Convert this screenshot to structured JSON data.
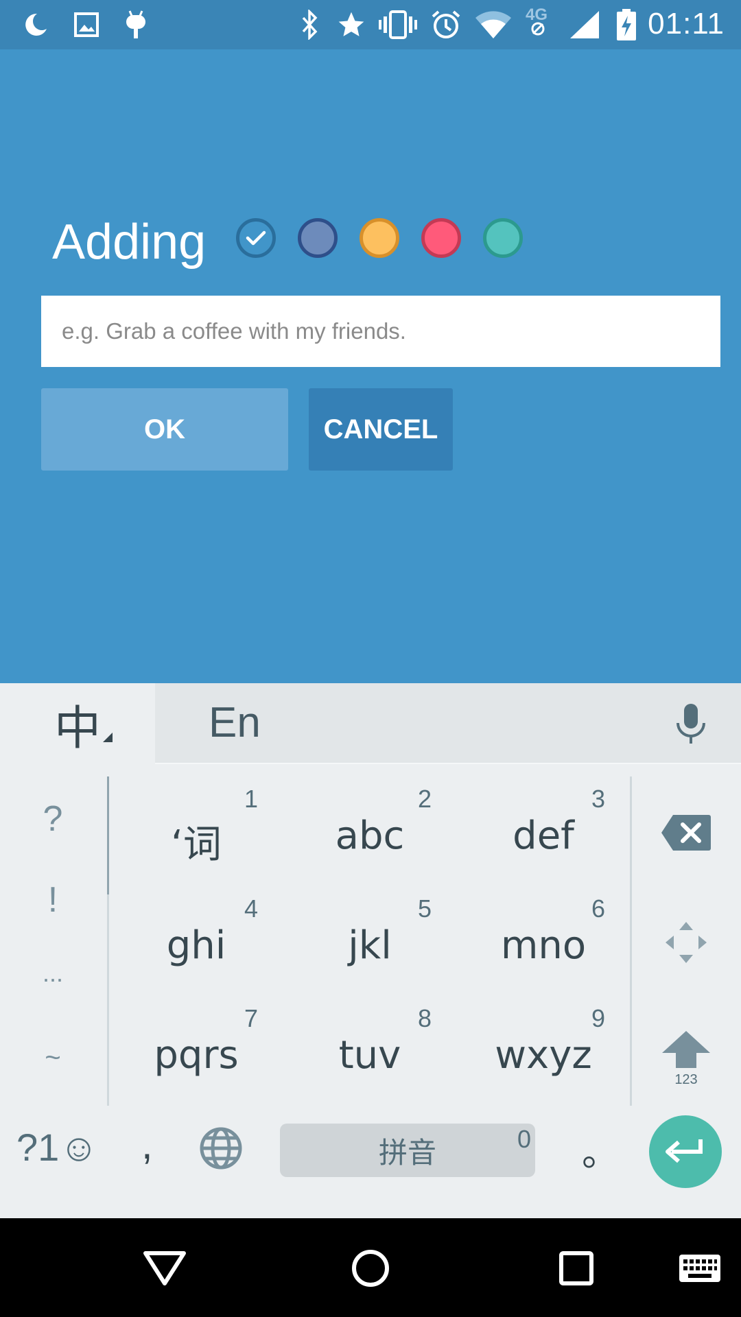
{
  "status_bar": {
    "time": "01:11",
    "network_label": "4G",
    "icons": [
      "moon-icon",
      "image-icon",
      "android-icon",
      "bluetooth-icon",
      "star-icon",
      "vibrate-icon",
      "alarm-icon",
      "wifi-icon",
      "data-off-icon",
      "signal-icon",
      "battery-charging-icon"
    ]
  },
  "main": {
    "title": "Adding",
    "colors": [
      {
        "name": "blue",
        "fill": "#4195c9",
        "border": "#2a6e9c",
        "selected": true
      },
      {
        "name": "indigo",
        "fill": "#6d8bbb",
        "border": "#2e4f8a",
        "selected": false
      },
      {
        "name": "amber",
        "fill": "#fdc05f",
        "border": "#d8902a",
        "selected": false
      },
      {
        "name": "pink",
        "fill": "#ff5a7a",
        "border": "#c43a55",
        "selected": false
      },
      {
        "name": "teal",
        "fill": "#54c3be",
        "border": "#2c9a8e",
        "selected": false
      }
    ],
    "input": {
      "value": "",
      "placeholder": "e.g. Grab a coffee with my friends."
    },
    "ok_label": "OK",
    "cancel_label": "CANCEL"
  },
  "keyboard": {
    "lang_key": "中",
    "candidate": "En",
    "symbols": [
      "?",
      "!",
      "...",
      "~"
    ],
    "keys": [
      {
        "label": "‘词",
        "num": "1"
      },
      {
        "label": "abc",
        "num": "2"
      },
      {
        "label": "def",
        "num": "3"
      },
      {
        "label": "ghi",
        "num": "4"
      },
      {
        "label": "jkl",
        "num": "5"
      },
      {
        "label": "mno",
        "num": "6"
      },
      {
        "label": "pqrs",
        "num": "7"
      },
      {
        "label": "tuv",
        "num": "8"
      },
      {
        "label": "wxyz",
        "num": "9"
      }
    ],
    "shift_sub": "123",
    "bottom": {
      "symbols_key": "?1☺",
      "comma": ",",
      "space_label": "拼音",
      "space_num": "0",
      "period": "。"
    }
  },
  "nav_bar": {
    "icons": [
      "back-icon",
      "home-icon",
      "recents-icon",
      "keyboard-switch-icon"
    ]
  }
}
